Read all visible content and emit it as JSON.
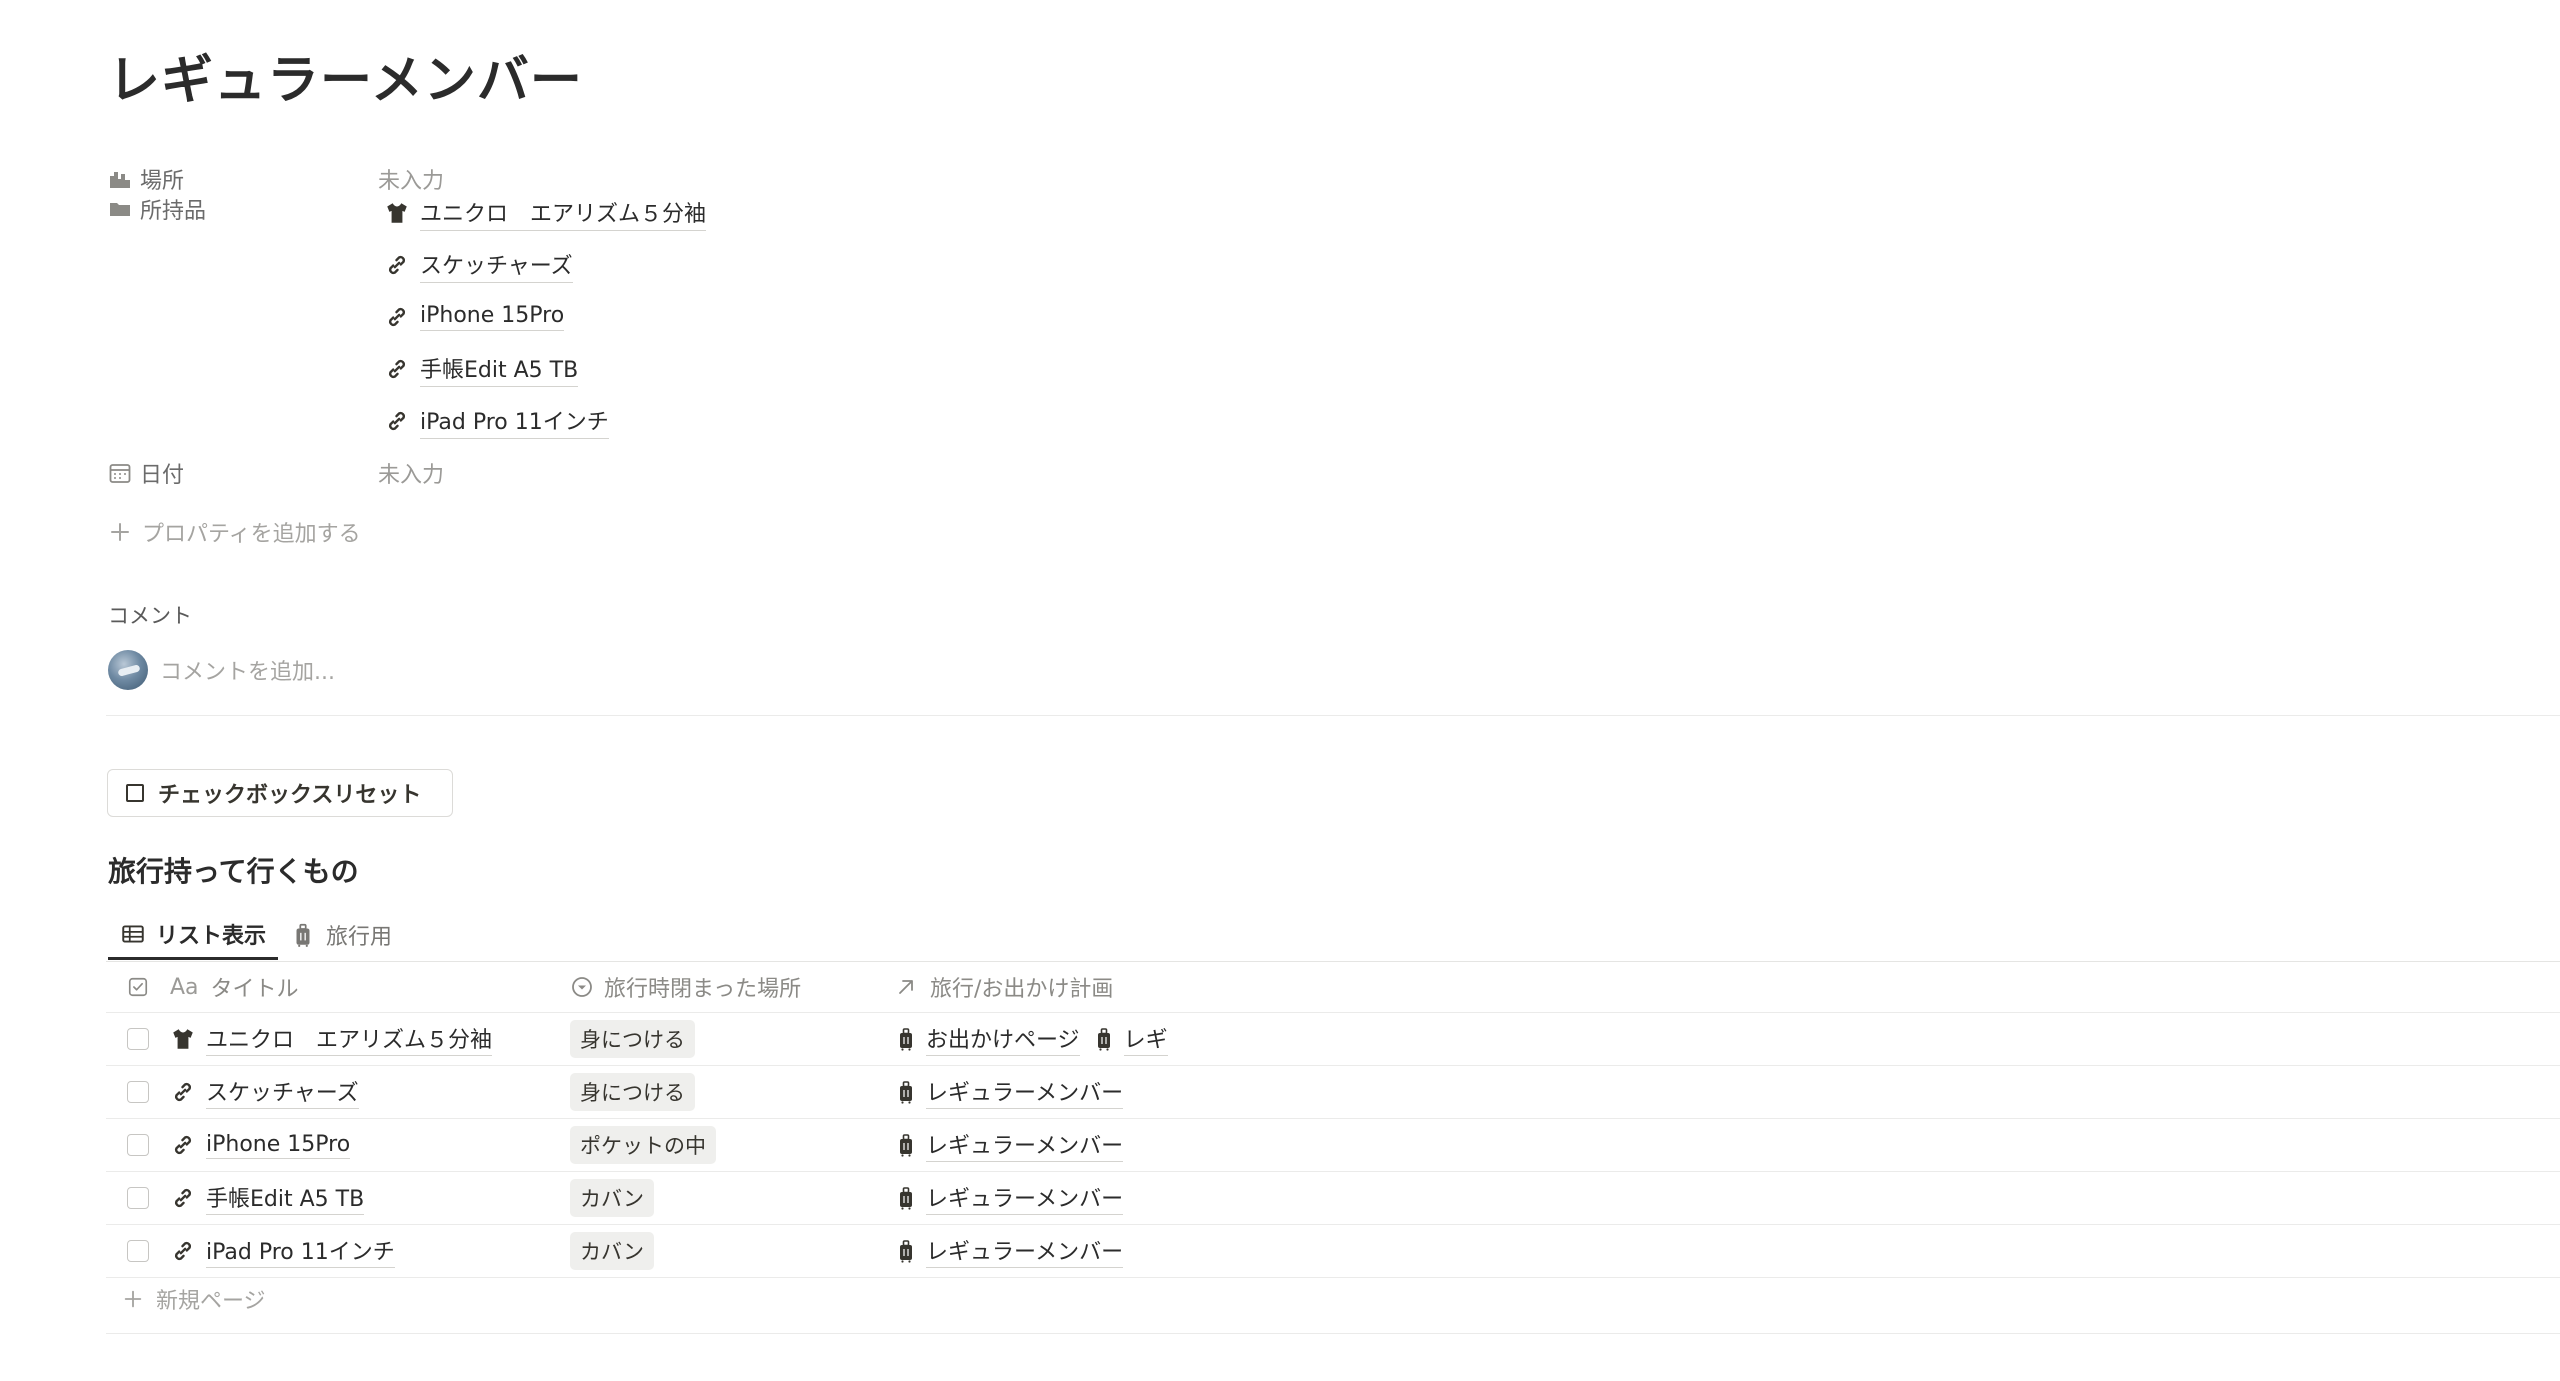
{
  "page": {
    "title": "レギュラーメンバー"
  },
  "properties": {
    "location": {
      "name": "場所",
      "value": "未入力",
      "icon": "building-icon"
    },
    "items": {
      "name": "所持品",
      "icon": "folder-icon",
      "values": [
        {
          "label": "ユニクロ　エアリズム５分袖",
          "icon": "tshirt-icon"
        },
        {
          "label": "スケッチャーズ",
          "icon": "link-icon"
        },
        {
          "label": "iPhone 15Pro",
          "icon": "link-icon"
        },
        {
          "label": "手帳Edit A5 TB",
          "icon": "link-icon"
        },
        {
          "label": "iPad Pro 11インチ",
          "icon": "link-icon"
        }
      ]
    },
    "date": {
      "name": "日付",
      "value": "未入力",
      "icon": "calendar-icon"
    },
    "add_label": "プロパティを追加する"
  },
  "comments": {
    "label": "コメント",
    "placeholder": "コメントを追加..."
  },
  "reset_button": {
    "label": "チェックボックスリセット"
  },
  "database": {
    "title": "旅行持って行くもの",
    "tabs": [
      {
        "label": "リスト表示",
        "icon": "table-icon",
        "active": true
      },
      {
        "label": "旅行用",
        "icon": "luggage-icon",
        "active": false
      }
    ],
    "columns": {
      "title_prefix": "Aa",
      "title": "タイトル",
      "place": "旅行時閉まった場所",
      "plan": "旅行/お出かけ計画"
    },
    "rows": [
      {
        "title": "ユニクロ　エアリズム５分袖",
        "icon": "tshirt-icon",
        "place": "身につける",
        "plans": [
          "お出かけページ",
          "レギ"
        ]
      },
      {
        "title": "スケッチャーズ",
        "icon": "link-icon",
        "place": "身につける",
        "plans": [
          "レギュラーメンバー"
        ]
      },
      {
        "title": "iPhone 15Pro",
        "icon": "link-icon",
        "place": "ポケットの中",
        "plans": [
          "レギュラーメンバー"
        ]
      },
      {
        "title": "手帳Edit A5 TB",
        "icon": "link-icon",
        "place": "カバン",
        "plans": [
          "レギュラーメンバー"
        ]
      },
      {
        "title": "iPad Pro 11インチ",
        "icon": "link-icon",
        "place": "カバン",
        "plans": [
          "レギュラーメンバー"
        ]
      }
    ],
    "new_page_label": "新規ページ"
  }
}
